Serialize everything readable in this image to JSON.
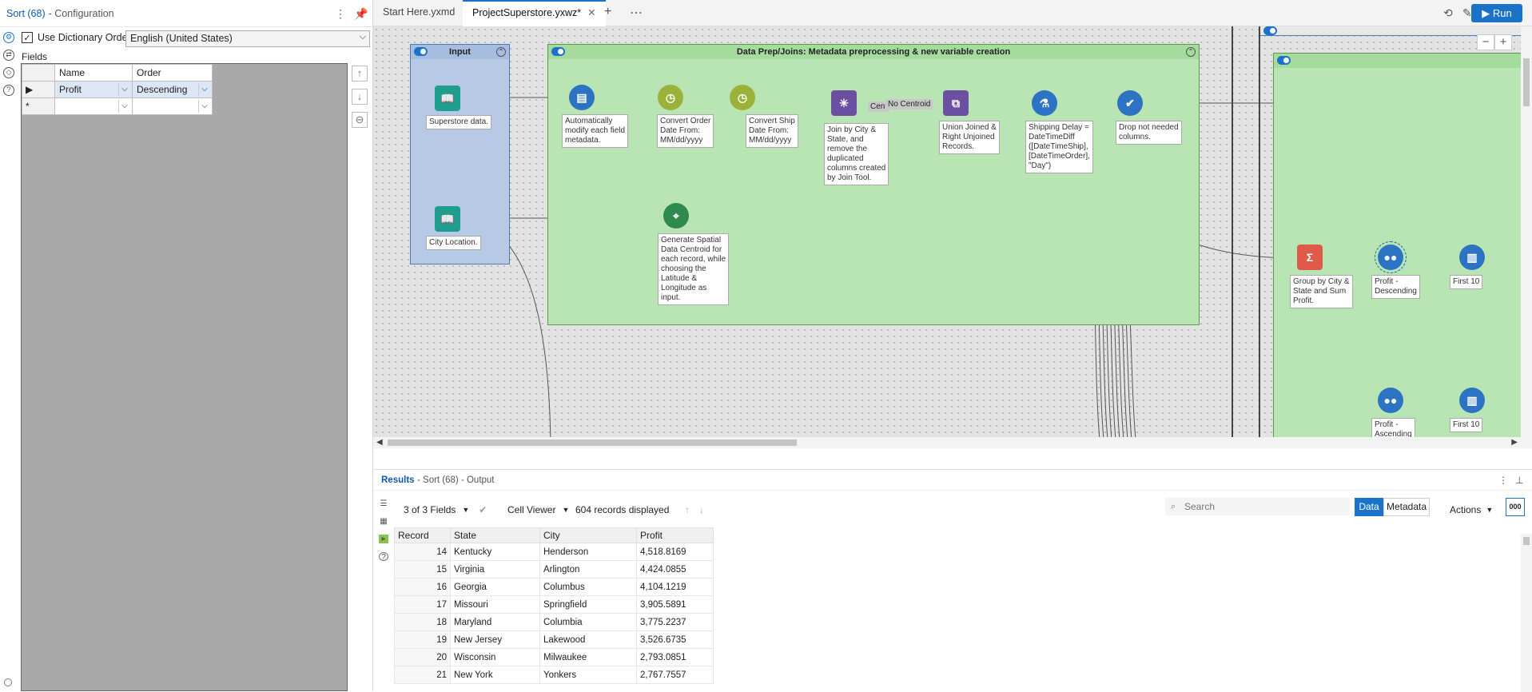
{
  "config": {
    "title": "Sort (68)",
    "subtitle": "- Configuration",
    "dict_order_label": "Use Dictionary Order",
    "dict_order_checked": true,
    "language": "English (United States)",
    "fields_label": "Fields",
    "columns": [
      "Name",
      "Order"
    ],
    "rows": [
      {
        "name": "Profit",
        "order": "Descending"
      },
      {
        "name": "",
        "order": ""
      }
    ]
  },
  "tabs": [
    {
      "label": "Start Here.yxmd",
      "active": false
    },
    {
      "label": "ProjectSuperstore.yxwz*",
      "active": true
    }
  ],
  "run_label": "Run",
  "canvas": {
    "input_container": "Input",
    "prep_container": "Data Prep/Joins: Metadata preprocessing & new variable creation",
    "join_labels": [
      "Cent",
      "No Centroid"
    ],
    "tools": [
      {
        "id": "superstore",
        "label": "Superstore data."
      },
      {
        "id": "city",
        "label": "City Location."
      },
      {
        "id": "autofield",
        "label": "Automatically\nmodify each field\nmetadata."
      },
      {
        "id": "convert_order",
        "label": "Convert Order\nDate From:\nMM/dd/yyyy"
      },
      {
        "id": "convert_ship",
        "label": "Convert Ship\nDate From:\nMM/dd/yyyy"
      },
      {
        "id": "join",
        "label": "Join by City &\nState, and\nremove the\nduplicated\ncolumns created\nby Join Tool."
      },
      {
        "id": "union",
        "label": "Union Joined &\nRight Unjoined\nRecords."
      },
      {
        "id": "formula",
        "label": "Shipping Delay =\nDateTimeDiff\n([DateTimeShip],\n[DateTimeOrder],\n\"Day\")"
      },
      {
        "id": "select",
        "label": "Drop not needed\ncolumns."
      },
      {
        "id": "spatial",
        "label": "Generate Spatial\nData Centroid for\neach record, while\nchoosing the\nLatitude &\nLongitude as\ninput."
      },
      {
        "id": "summarize",
        "label": "Group by City &\nState and Sum\nProfit."
      },
      {
        "id": "sort_desc",
        "label": "Profit -\nDescending"
      },
      {
        "id": "first10a",
        "label": "First 10"
      },
      {
        "id": "sort_asc",
        "label": "Profit -\nAscending"
      },
      {
        "id": "first10b",
        "label": "First 10"
      }
    ]
  },
  "results": {
    "title": "Results",
    "subtitle": "- Sort (68) - Output",
    "fields_count": "3 of 3 Fields",
    "viewer": "Cell Viewer",
    "records_displayed": "604 records displayed",
    "search_placeholder": "Search",
    "data_btn": "Data",
    "metadata_btn": "Metadata",
    "actions": "Actions",
    "columns": [
      "Record",
      "State",
      "City",
      "Profit"
    ],
    "rows": [
      [
        "14",
        "Kentucky",
        "Henderson",
        "4,518.8169"
      ],
      [
        "15",
        "Virginia",
        "Arlington",
        "4,424.0855"
      ],
      [
        "16",
        "Georgia",
        "Columbus",
        "4,104.1219"
      ],
      [
        "17",
        "Missouri",
        "Springfield",
        "3,905.5891"
      ],
      [
        "18",
        "Maryland",
        "Columbia",
        "3,775.2237"
      ],
      [
        "19",
        "New Jersey",
        "Lakewood",
        "3,526.6735"
      ],
      [
        "20",
        "Wisconsin",
        "Milwaukee",
        "2,793.0851"
      ],
      [
        "21",
        "New York",
        "Yonkers",
        "2,767.7557"
      ]
    ]
  },
  "colors": {
    "accent": "#1a73c9",
    "input_container": "#b8c9e6",
    "prep_container": "#b9e4b4",
    "input_tool": "#1f9e8f",
    "prep_tool": "#9bb23a",
    "join_tool": "#6b4fa0",
    "spatial_tool": "#2f8a4f",
    "transform_tool": "#e05a4a",
    "preparation_tool": "#2d73c4"
  }
}
